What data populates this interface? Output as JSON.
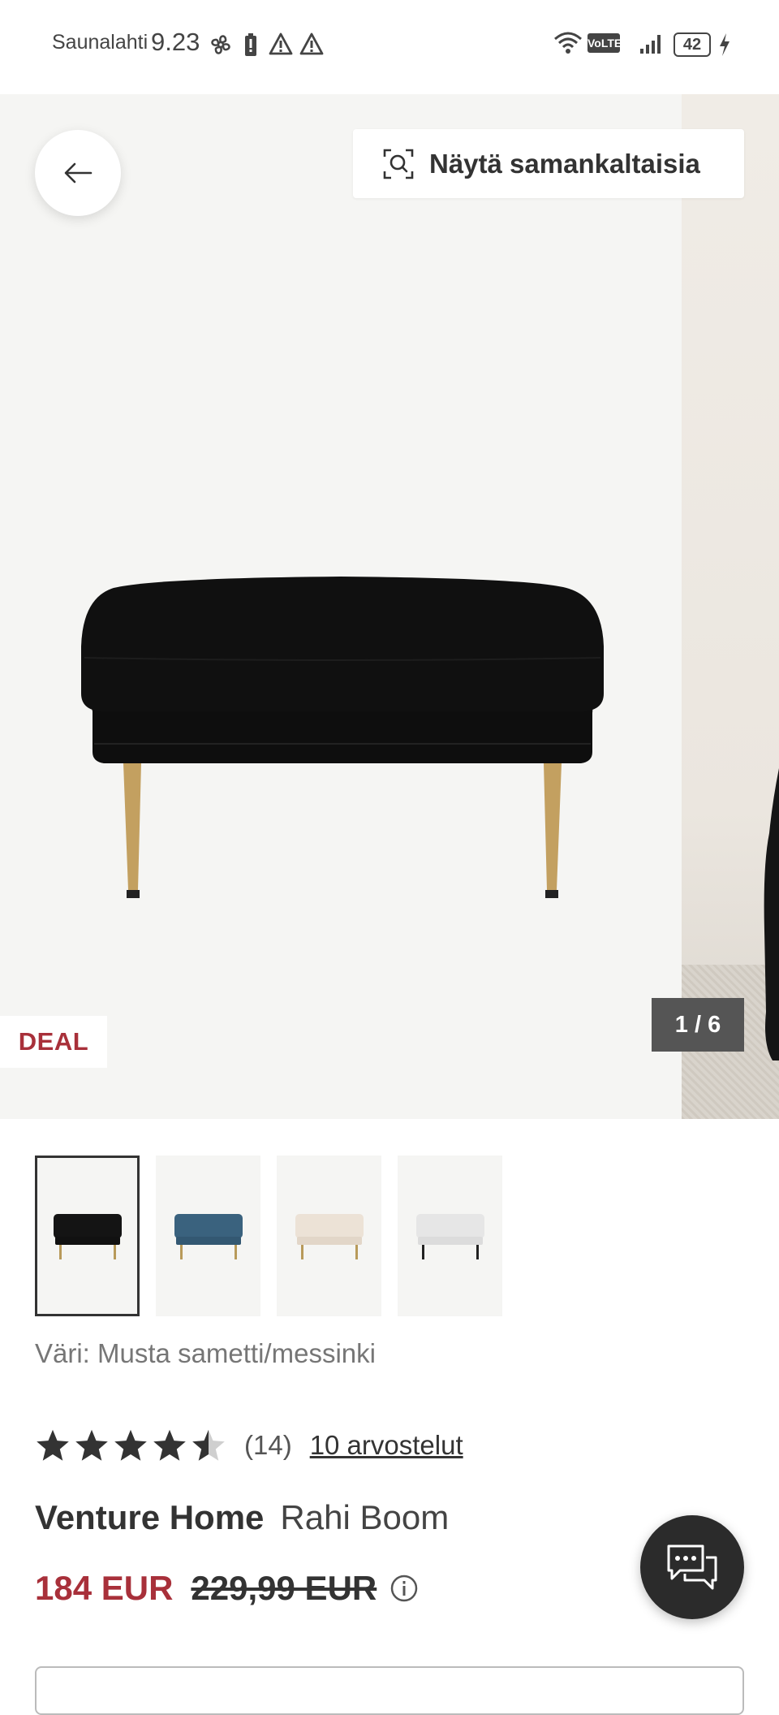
{
  "status_bar": {
    "carrier": "Saunalahti",
    "time": "9.23",
    "network_badge": "VoLTE",
    "battery": "42",
    "icons": [
      "fan-icon",
      "battery-saver-icon",
      "warning-icon",
      "warning-icon",
      "wifi-icon",
      "volte-icon",
      "signal-icon",
      "battery-icon",
      "charging-icon"
    ]
  },
  "gallery": {
    "similar_button_label": "Näytä samankaltaisia",
    "deal_badge": "DEAL",
    "pager": "1 / 6",
    "colors": {
      "background": "#f5f5f3",
      "deal": "#a8303a",
      "pager_bg": "#555555"
    }
  },
  "thumbnails": [
    {
      "color_name": "black",
      "swatch": "#141414",
      "legs": "#b89a5a",
      "selected": true
    },
    {
      "color_name": "blue",
      "swatch": "#3a627e",
      "legs": "#b89a5a",
      "selected": false
    },
    {
      "color_name": "beige",
      "swatch": "#ece2d6",
      "legs": "#b89a5a",
      "selected": false
    },
    {
      "color_name": "light grey",
      "swatch": "#e6e6e6",
      "legs": "#222222",
      "selected": false
    }
  ],
  "product": {
    "color_label": "Väri:",
    "color_value": "Musta sametti/messinki",
    "rating": {
      "value": 4.5,
      "max": 5,
      "count_text": "(14)",
      "reviews_link": "10 arvostelut"
    },
    "brand": "Venture Home",
    "name": "Rahi Boom",
    "price_current": "184 EUR",
    "price_original": "229,99 EUR",
    "accent_color": "#a8303a"
  }
}
